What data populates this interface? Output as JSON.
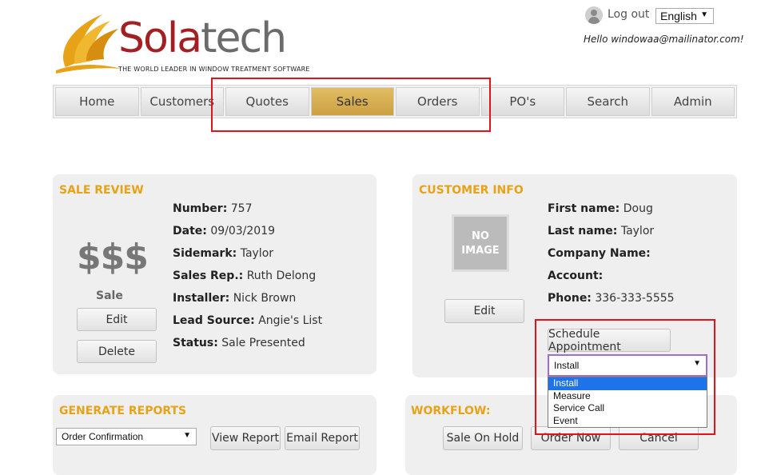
{
  "brand": {
    "word_part1": "Sola",
    "word_part2": "tech",
    "tagline": "THE WORLD LEADER IN WINDOW TREATMENT SOFTWARE"
  },
  "header": {
    "logout": "Log out",
    "language": "English",
    "greeting": "Hello windowaa@mailinator.com!"
  },
  "nav": {
    "items": [
      "Home",
      "Customers",
      "Quotes",
      "Sales",
      "Orders",
      "PO's",
      "Search",
      "Admin"
    ],
    "active": "Sales"
  },
  "sale_review": {
    "title": "SALE REVIEW",
    "symbol": "$$$",
    "type_label": "Sale",
    "edit": "Edit",
    "delete": "Delete",
    "fields": [
      {
        "label": "Number:",
        "value": "757"
      },
      {
        "label": "Date:",
        "value": "09/03/2019"
      },
      {
        "label": "Sidemark:",
        "value": "Taylor"
      },
      {
        "label": "Sales Rep.:",
        "value": "Ruth Delong"
      },
      {
        "label": "Installer:",
        "value": "Nick Brown"
      },
      {
        "label": "Lead Source:",
        "value": "Angie's List"
      },
      {
        "label": "Status:",
        "value": "Sale Presented"
      }
    ]
  },
  "customer_info": {
    "title": "CUSTOMER INFO",
    "no_image_line1": "NO",
    "no_image_line2": "IMAGE",
    "edit": "Edit",
    "fields": [
      {
        "label": "First name:",
        "value": "Doug"
      },
      {
        "label": "Last name:",
        "value": "Taylor"
      },
      {
        "label": "Company Name:",
        "value": ""
      },
      {
        "label": "Account:",
        "value": ""
      },
      {
        "label": "Phone:",
        "value": "336-333-5555"
      }
    ],
    "schedule_button": "Schedule Appointment",
    "appointment_type": {
      "selected": "Install",
      "options": [
        "Install",
        "Measure",
        "Service Call",
        "Event"
      ]
    }
  },
  "generate_reports": {
    "title": "GENERATE REPORTS",
    "selected_report": "Order Confirmation",
    "view": "View Report",
    "email": "Email Report"
  },
  "workflow": {
    "title": "WORKFLOW:",
    "hold": "Sale On Hold",
    "order": "Order Now",
    "cancel": "Cancel"
  },
  "colors": {
    "accent_orange": "#e8a217",
    "brand_red": "#a21f24",
    "active_tab": "#d4aa4c",
    "highlight_red": "#e2131a",
    "option_selected": "#1e73e8"
  }
}
